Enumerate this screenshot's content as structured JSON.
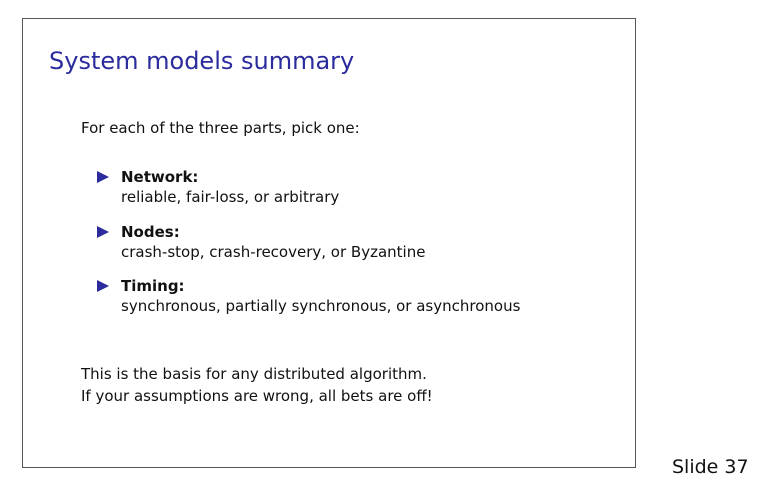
{
  "slide": {
    "title": "System models summary",
    "intro": "For each of the three parts, pick one:",
    "items": [
      {
        "heading": "Network:",
        "text": "reliable, fair-loss, or arbitrary"
      },
      {
        "heading": "Nodes:",
        "text": "crash-stop, crash-recovery, or Byzantine"
      },
      {
        "heading": "Timing:",
        "text": "synchronous, partially synchronous, or asynchronous"
      }
    ],
    "closing": [
      "This is the basis for any distributed algorithm.",
      "If your assumptions are wrong, all bets are off!"
    ],
    "number_label": "Slide 37"
  },
  "colors": {
    "title": "#2b2b9e",
    "bullet": "#2b2b9e",
    "text": "#111111",
    "frame": "#555555"
  },
  "icons": {
    "bullet": "triangle-right-icon"
  }
}
